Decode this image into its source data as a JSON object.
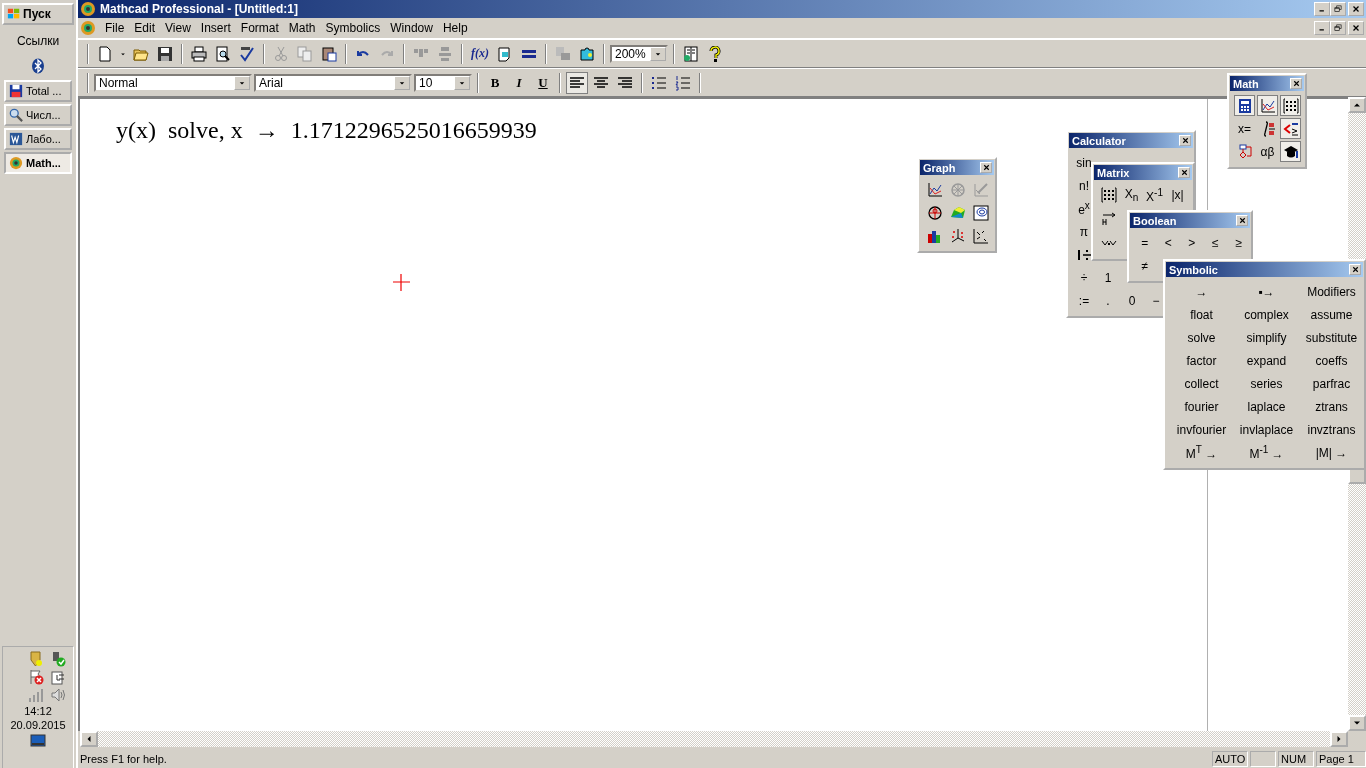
{
  "taskbar": {
    "start": "Пуск",
    "links": "Ссылки",
    "items": [
      {
        "label": "Total ...",
        "selected": false
      },
      {
        "label": "Числ...",
        "selected": false
      },
      {
        "label": "Лабо...",
        "selected": false
      },
      {
        "label": "Math...",
        "selected": true
      }
    ],
    "clock": "14:12",
    "date": "20.09.2015"
  },
  "window": {
    "title": "Mathcad Professional - [Untitled:1]"
  },
  "menu": [
    "File",
    "Edit",
    "View",
    "Insert",
    "Format",
    "Math",
    "Symbolics",
    "Window",
    "Help"
  ],
  "toolbar": {
    "function_button": "f(x)",
    "zoom": "200%"
  },
  "format_bar": {
    "style": "Normal",
    "font": "Arial",
    "size": "10",
    "style_buttons": [
      "B",
      "I",
      "U"
    ],
    "align_buttons": [
      {
        "selected": true
      },
      {
        "selected": false
      },
      {
        "selected": false
      }
    ]
  },
  "document": {
    "expression": "y(x)  solve, x  →  1.1712296525016659939"
  },
  "palettes": [
    {
      "title": "Math",
      "rows": [
        [
          {
            "kind": "icon",
            "on": true
          },
          {
            "kind": "icon",
            "on": true
          },
          {
            "kind": "icon",
            "on": true
          }
        ],
        [
          {
            "kind": "text",
            "label": "x=",
            "on": false
          },
          {
            "kind": "icon",
            "on": false
          },
          {
            "kind": "icon",
            "on": true
          }
        ],
        [
          {
            "kind": "icon",
            "on": false
          },
          {
            "kind": "text",
            "label": "αβ",
            "on": false
          },
          {
            "kind": "icon",
            "on": true
          }
        ]
      ]
    },
    {
      "title": "Graph",
      "rows": [
        [
          {
            "kind": "icon"
          },
          {
            "kind": "icon"
          },
          {
            "kind": "icon"
          }
        ],
        [
          {
            "kind": "icon"
          },
          {
            "kind": "icon"
          },
          {
            "kind": "icon"
          }
        ],
        [
          {
            "kind": "icon"
          },
          {
            "kind": "icon"
          },
          {
            "kind": "icon"
          }
        ]
      ]
    },
    {
      "title": "Calculator",
      "rows": [
        [
          {
            "kind": "text",
            "label": "sin"
          }
        ],
        [
          {
            "kind": "text",
            "label": "n!"
          }
        ],
        [
          {
            "kind": "text",
            "label": "e$^{x}$"
          }
        ],
        [
          {
            "kind": "text",
            "label": "π"
          }
        ],
        [
          {
            "kind": "icon"
          }
        ],
        [
          {
            "kind": "text",
            "label": "÷"
          },
          {
            "kind": "text",
            "label": "1"
          }
        ],
        [
          {
            "kind": "text",
            "label": ":="
          },
          {
            "kind": "text",
            "label": "."
          },
          {
            "kind": "text",
            "label": "0"
          },
          {
            "kind": "text",
            "label": "−"
          }
        ]
      ]
    },
    {
      "title": "Matrix",
      "rows": [
        [
          {
            "kind": "icon"
          },
          {
            "kind": "text",
            "label": "X$_{n}$"
          },
          {
            "kind": "text",
            "label": "X$^{-1}$"
          },
          {
            "kind": "text",
            "label": "|x|"
          }
        ],
        [
          {
            "kind": "icon"
          }
        ],
        [
          {
            "kind": "icon"
          }
        ]
      ]
    },
    {
      "title": "Boolean",
      "rows": [
        [
          {
            "kind": "text",
            "label": "="
          },
          {
            "kind": "text",
            "label": "<"
          },
          {
            "kind": "text",
            "label": ">"
          },
          {
            "kind": "text",
            "label": "≤"
          },
          {
            "kind": "text",
            "label": "≥"
          }
        ],
        [
          {
            "kind": "text",
            "label": "≠"
          }
        ]
      ]
    },
    {
      "title": "Symbolic",
      "rows": [
        [
          {
            "kind": "text",
            "label": "→"
          },
          {
            "kind": "text",
            "label": "▪→"
          },
          {
            "kind": "text",
            "label": "Modifiers"
          }
        ],
        [
          {
            "kind": "text",
            "label": "float"
          },
          {
            "kind": "text",
            "label": "complex"
          },
          {
            "kind": "text",
            "label": "assume"
          }
        ],
        [
          {
            "kind": "text",
            "label": "solve"
          },
          {
            "kind": "text",
            "label": "simplify"
          },
          {
            "kind": "text",
            "label": "substitute"
          }
        ],
        [
          {
            "kind": "text",
            "label": "factor"
          },
          {
            "kind": "text",
            "label": "expand"
          },
          {
            "kind": "text",
            "label": "coeffs"
          }
        ],
        [
          {
            "kind": "text",
            "label": "collect"
          },
          {
            "kind": "text",
            "label": "series"
          },
          {
            "kind": "text",
            "label": "parfrac"
          }
        ],
        [
          {
            "kind": "text",
            "label": "fourier"
          },
          {
            "kind": "text",
            "label": "laplace"
          },
          {
            "kind": "text",
            "label": "ztrans"
          }
        ],
        [
          {
            "kind": "text",
            "label": "invfourier"
          },
          {
            "kind": "text",
            "label": "invlaplace"
          },
          {
            "kind": "text",
            "label": "invztrans"
          }
        ],
        [
          {
            "kind": "text",
            "label": "M$^{T}$ →"
          },
          {
            "kind": "text",
            "label": "M$^{-1}$ →"
          },
          {
            "kind": "text",
            "label": "|M| →"
          }
        ]
      ]
    }
  ],
  "status_bar": {
    "help": "Press F1 for help.",
    "cells": [
      "AUTO",
      "NUM",
      "Page 1"
    ]
  }
}
